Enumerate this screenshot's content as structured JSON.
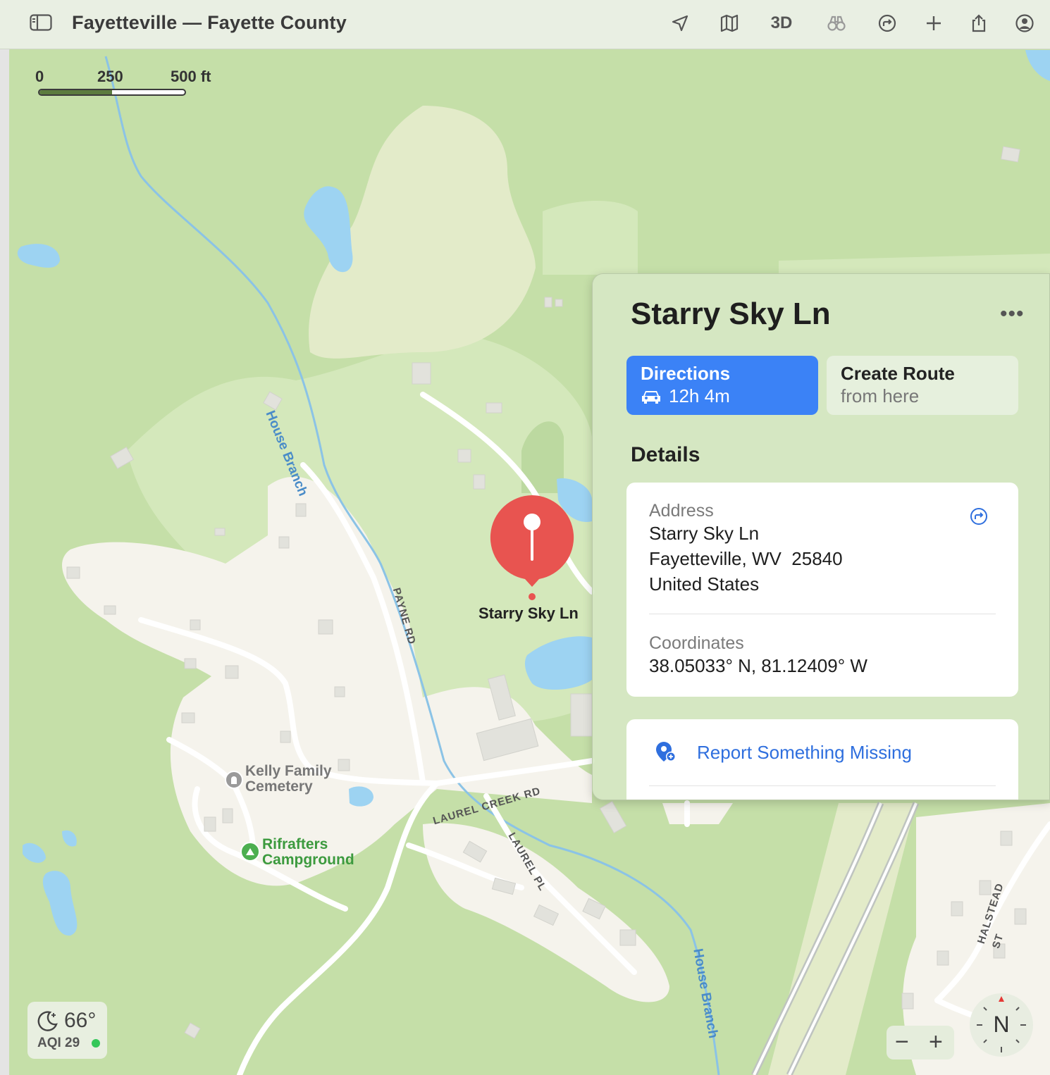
{
  "window": {
    "title": "Fayetteville — Fayette County",
    "toolbar": {
      "location_icon": "location-arrow-icon",
      "map_mode_icon": "map-icon",
      "three_d_label": "3D",
      "lookaround_icon": "binoculars-icon",
      "directions_icon": "directions-icon",
      "add_icon": "plus-icon",
      "share_icon": "share-icon",
      "account_icon": "account-icon"
    }
  },
  "scale": {
    "labels": [
      "0",
      "250",
      "500 ft"
    ]
  },
  "map_labels": {
    "creek_upper": "House Branch",
    "creek_lower": "House Branch",
    "payne_rd": "PAYNE RD",
    "laurel_creek_rd": "LAUREL CREEK RD",
    "laurel_pl": "LAUREL PL",
    "halstead_st": "HALSTEAD ST",
    "pin_label": "Starry Sky Ln",
    "cemetery_line1": "Kelly Family",
    "cemetery_line2": "Cemetery",
    "campground_line1": "Rifrafters",
    "campground_line2": "Campground"
  },
  "panel": {
    "title": "Starry Sky Ln",
    "more_label": "•••",
    "directions": {
      "label": "Directions",
      "eta": "12h 4m"
    },
    "create_route": {
      "label": "Create Route",
      "sub": "from here"
    },
    "details_heading": "Details",
    "address": {
      "label": "Address",
      "line1": "Starry Sky Ln",
      "line2": "Fayetteville, WV  25840",
      "line3": "United States"
    },
    "coordinates": {
      "label": "Coordinates",
      "value": "38.05033° N, 81.12409° W"
    },
    "report_label": "Report Something Missing"
  },
  "weather": {
    "temperature": "66°",
    "aqi": "AQI 29"
  },
  "zoom": {
    "minus": "−",
    "plus": "+"
  },
  "compass": {
    "label": "N"
  },
  "colors": {
    "forest": "#c5dfa8",
    "open_land": "#d4e8bb",
    "meadow": "#e3ebc9",
    "developed": "#f5f3ec",
    "water": "#9dd3f2",
    "pin": "#e85450",
    "accent": "#3b82f6"
  }
}
